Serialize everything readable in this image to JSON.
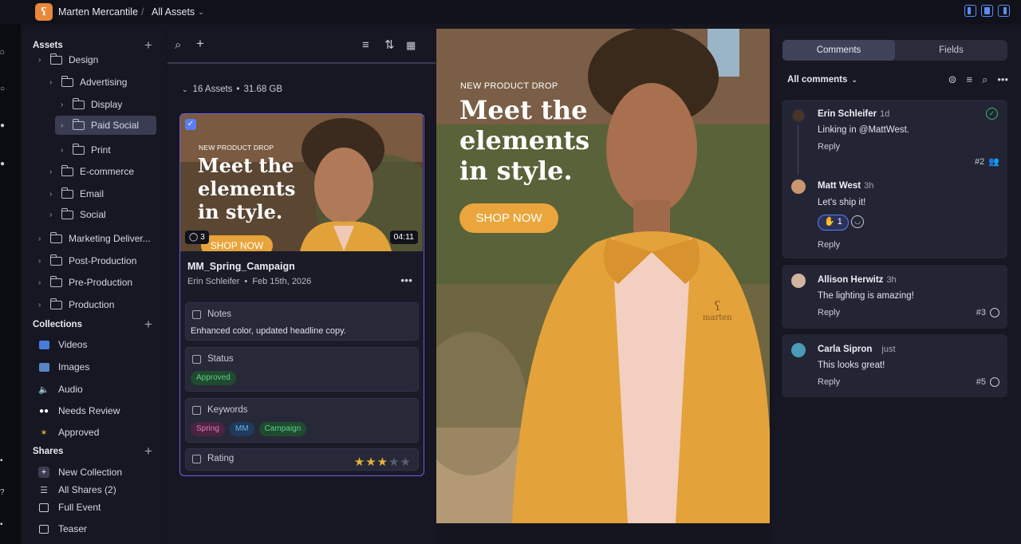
{
  "header": {
    "workspace": "Marten Mercantile",
    "page": "All Assets"
  },
  "sidebar": {
    "assets_title": "Assets",
    "tree": [
      {
        "label": "Design",
        "depth": 0
      },
      {
        "label": "Advertising",
        "depth": 1
      },
      {
        "label": "Display",
        "depth": 2
      },
      {
        "label": "Paid Social",
        "depth": 2,
        "selected": true
      },
      {
        "label": "Print",
        "depth": 2
      },
      {
        "label": "E-commerce",
        "depth": 1
      },
      {
        "label": "Email",
        "depth": 1
      },
      {
        "label": "Social",
        "depth": 1
      },
      {
        "label": "Marketing Deliver...",
        "depth": 0
      },
      {
        "label": "Post-Production",
        "depth": 0
      },
      {
        "label": "Pre-Production",
        "depth": 0
      },
      {
        "label": "Production",
        "depth": 0
      }
    ],
    "collections_title": "Collections",
    "collections": [
      {
        "label": "Videos",
        "icon": "video-icon"
      },
      {
        "label": "Images",
        "icon": "image-icon"
      },
      {
        "label": "Audio",
        "icon": "audio-icon"
      },
      {
        "label": "Needs Review",
        "icon": "eyes-icon"
      },
      {
        "label": "Approved",
        "icon": "party-icon"
      }
    ],
    "shares_title": "Shares",
    "shares": [
      {
        "label": "New Collection",
        "icon": "plus-icon"
      },
      {
        "label": "All Shares (2)",
        "icon": "list-icon"
      },
      {
        "label": "Full Event",
        "icon": "share-icon"
      },
      {
        "label": "Teaser",
        "icon": "share-icon"
      }
    ]
  },
  "assets": {
    "count": "16 Assets",
    "size": "31.68 GB",
    "card": {
      "kicker": "NEW PRODUCT DROP",
      "headline": "Meet the elements in style.",
      "cta": "SHOP NOW",
      "comment_count": "3",
      "duration": "04:11",
      "title": "MM_Spring_Campaign",
      "author": "Erin Schleifer",
      "date": "Feb 15th, 2026",
      "notes_label": "Notes",
      "notes_value": "Enhanced color, updated headline copy.",
      "status_label": "Status",
      "status_value": "Approved",
      "keywords_label": "Keywords",
      "keywords": [
        "Spring",
        "MM",
        "Campaign"
      ],
      "rating_label": "Rating",
      "rating": 3,
      "rating_max": 5
    }
  },
  "preview": {
    "kicker": "NEW PRODUCT DROP",
    "headline": "Meet the elements in style.",
    "cta": "SHOP NOW",
    "jacket_brand": "marten"
  },
  "comments": {
    "tabs": [
      "Comments",
      "Fields"
    ],
    "active_tab": "Comments",
    "filter": "All comments",
    "reply_label": "Reply",
    "threads": [
      {
        "author": "Erin Schleifer",
        "time": "1d",
        "text": "Linking in @MattWest.",
        "number": "#2",
        "replies": [
          {
            "author": "Matt West",
            "time": "3h",
            "text": "Let's ship it!",
            "reaction": "1"
          }
        ]
      },
      {
        "author": "Allison Herwitz",
        "time": "3h",
        "text": "The lighting is amazing!",
        "number": "#3"
      },
      {
        "author": "Carla Sipron",
        "time": "just",
        "text": "This looks great!",
        "number": "#5"
      }
    ]
  },
  "colors": {
    "accent": "#5b7cf5",
    "card_border": "#6d5ce8",
    "approved": "#3fb96a",
    "cta": "#eaa63c"
  }
}
